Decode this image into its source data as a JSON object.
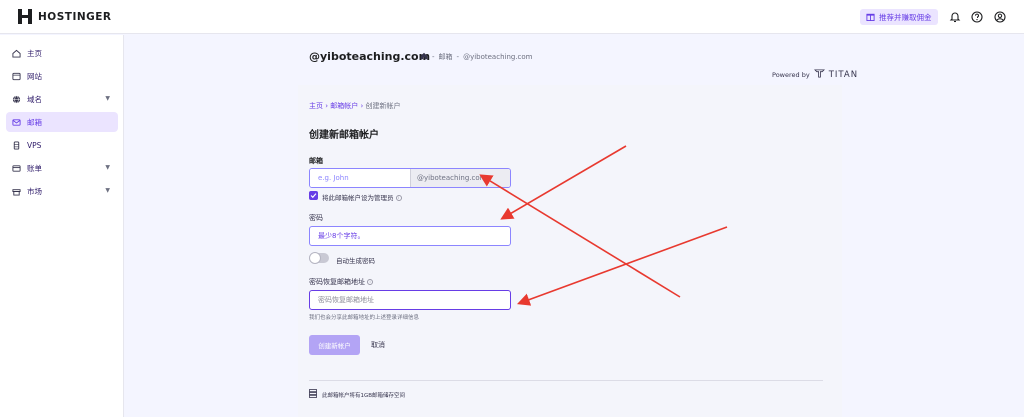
{
  "brand": {
    "name": "HOSTINGER"
  },
  "header": {
    "referral_label": "推荐并赚取佣金",
    "icons": [
      "gift-icon",
      "bell-icon",
      "help-icon",
      "account-icon"
    ]
  },
  "sidebar": {
    "items": [
      {
        "label": "主页",
        "icon": "home-icon"
      },
      {
        "label": "网站",
        "icon": "website-icon"
      },
      {
        "label": "域名",
        "icon": "globe-icon",
        "expandable": true
      },
      {
        "label": "邮箱",
        "icon": "mail-icon",
        "active": true
      },
      {
        "label": "VPS",
        "icon": "server-icon"
      },
      {
        "label": "账单",
        "icon": "card-icon",
        "expandable": true
      },
      {
        "label": "市场",
        "icon": "store-icon",
        "expandable": true
      }
    ]
  },
  "page": {
    "domain_title": "@yiboteaching.com",
    "top_crumbs": {
      "section": "邮箱",
      "domain": "@yiboteaching.com"
    },
    "powered_by": "Powered by",
    "powered_brand": "TITAN"
  },
  "form": {
    "breadcrumb": {
      "home": "主页",
      "accounts": "邮箱帐户",
      "current": "创建新帐户"
    },
    "title": "创建新邮箱帐户",
    "email_label": "邮箱",
    "email_placeholder": "e.g. John",
    "email_domain": "@yiboteaching.com",
    "admin_checkbox_label": "将此邮箱帐户设为管理员",
    "admin_checked": true,
    "password_label": "密码",
    "password_placeholder": "最少8个字符。",
    "auto_generate_label": "自动生成密码",
    "auto_generate_on": false,
    "recovery_label": "密码恢复邮箱地址",
    "recovery_placeholder": "密码恢复邮箱地址",
    "recovery_hint": "我们也会分享此邮箱地址的上述登录详细信息",
    "create_button": "创建新帐户",
    "cancel_button": "取消",
    "footer_note": "此邮箱帐户将有1GB邮箱储存空间"
  },
  "colors": {
    "accent": "#673de6",
    "accent_light": "#ebe4ff",
    "annotation_arrow": "#e8392f"
  }
}
